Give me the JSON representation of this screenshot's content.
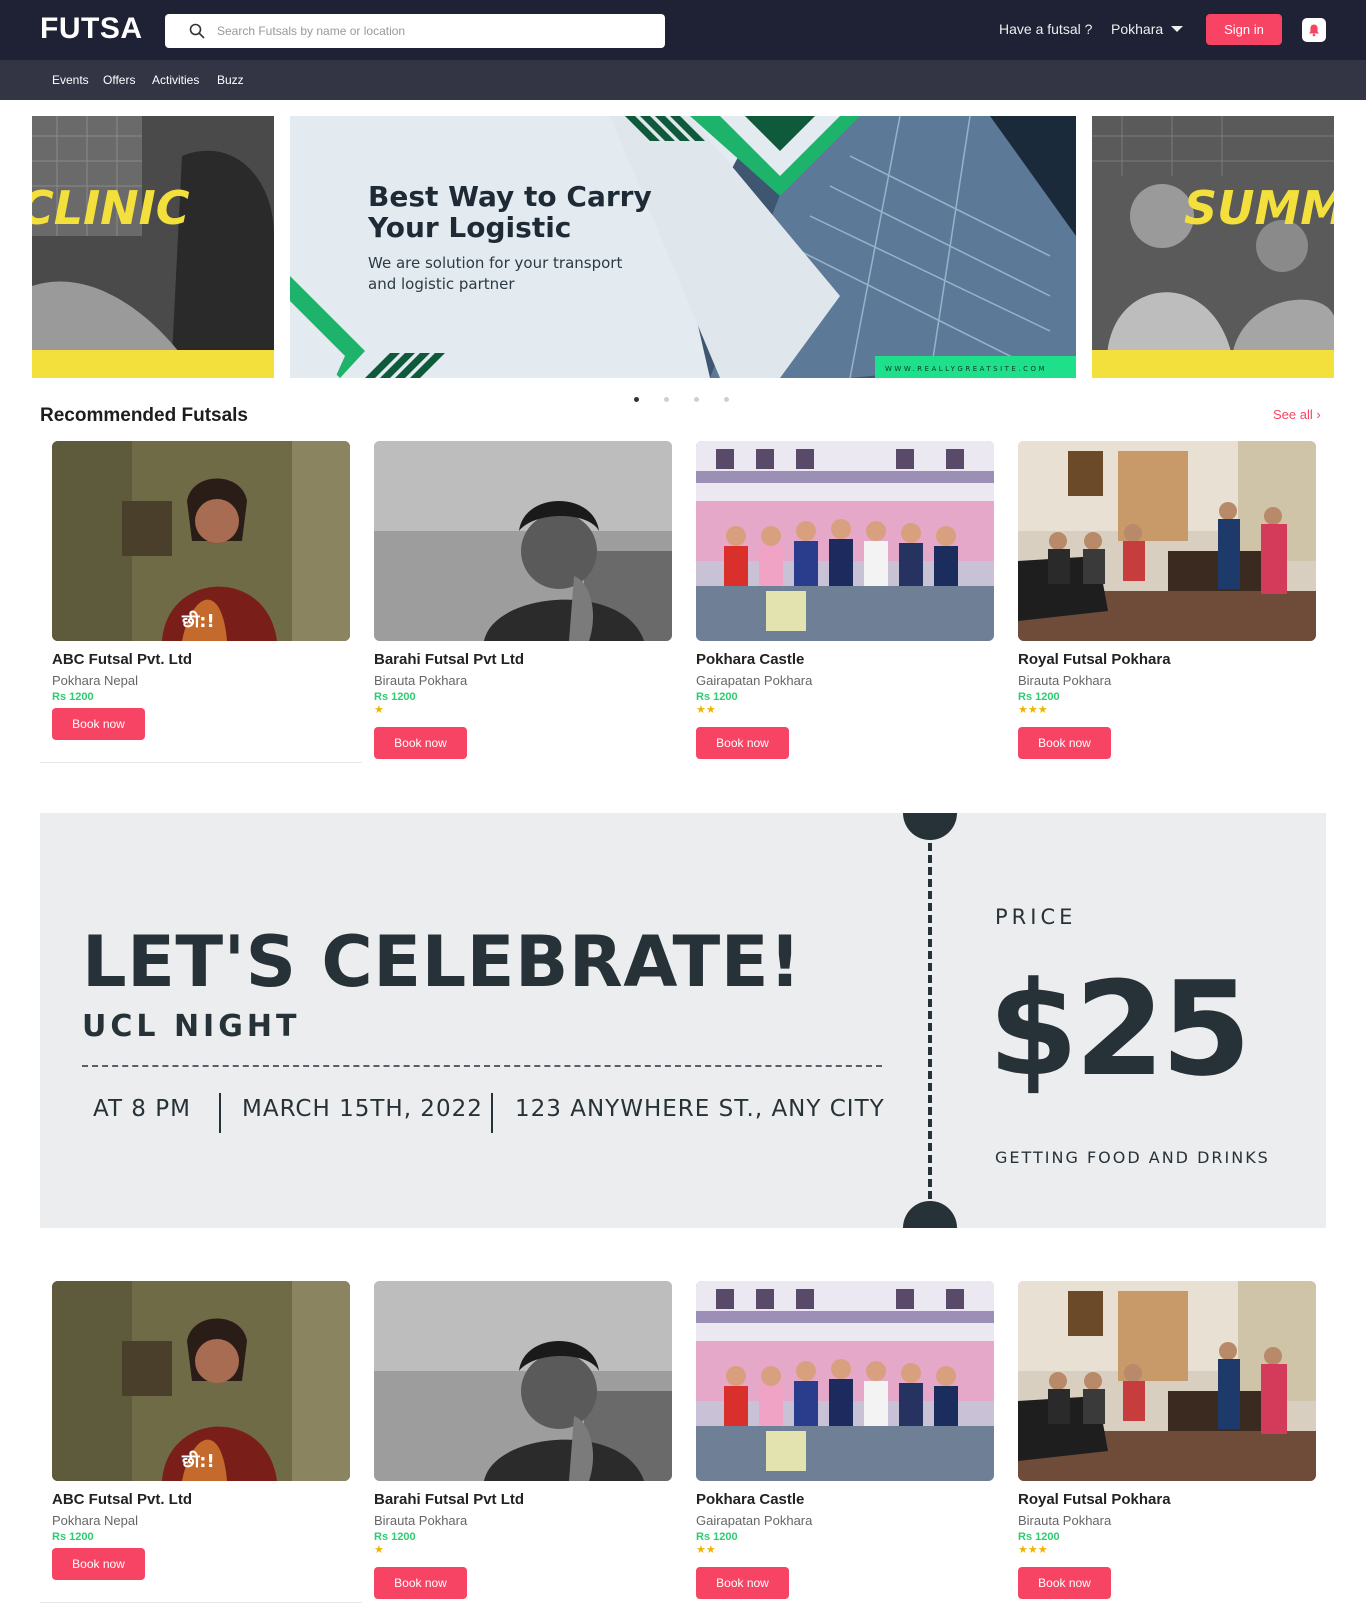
{
  "header": {
    "logo": "FUTSA",
    "search_placeholder": "Search Futsals by name or location",
    "have_futsal": "Have a futsal ?",
    "city": "Pokhara",
    "sign_in": "Sign in"
  },
  "subnav": [
    "Events",
    "Offers",
    "Activities",
    "Buzz"
  ],
  "carousel": {
    "left_text": "CLINIC",
    "main_title_line1": "Best Way to Carry",
    "main_title_line2": "Your Logistic",
    "main_sub_line1": "We are solution for your transport",
    "main_sub_line2": "and logistic partner",
    "main_url": "WWW.REALLYGREATSITE.COM",
    "right_text": "SUMM",
    "active_index": 0,
    "count": 4
  },
  "recommended": {
    "title": "Recommended Futsals",
    "see_all": "See all"
  },
  "cards": [
    {
      "name": "ABC Futsal Pvt. Ltd",
      "location": "Pokhara Nepal",
      "price": "Rs 1200",
      "stars": 0,
      "book": "Book now",
      "img_caption": "छी:!"
    },
    {
      "name": "Barahi Futsal Pvt Ltd",
      "location": "Birauta Pokhara",
      "price": "Rs 1200",
      "stars": 1,
      "book": "Book now"
    },
    {
      "name": "Pokhara Castle",
      "location": "Gairapatan Pokhara",
      "price": "Rs 1200",
      "stars": 2,
      "book": "Book now"
    },
    {
      "name": "Royal Futsal Pokhara",
      "location": "Birauta Pokhara",
      "price": "Rs 1200",
      "stars": 3,
      "book": "Book now"
    }
  ],
  "event": {
    "headline": "LET'S CELEBRATE!",
    "subtitle": "UCL NIGHT",
    "time": "AT 8 PM",
    "date": "MARCH 15TH, 2022",
    "address": "123 ANYWHERE ST., ANY CITY",
    "price_label": "PRICE",
    "price": "$25",
    "price_note": "GETTING FOOD AND DRINKS"
  },
  "colors": {
    "header_bg": "#1f2235",
    "subnav_bg": "#333545",
    "accent": "#f84464",
    "price_green": "#2ecc71",
    "star": "#f0b400"
  }
}
